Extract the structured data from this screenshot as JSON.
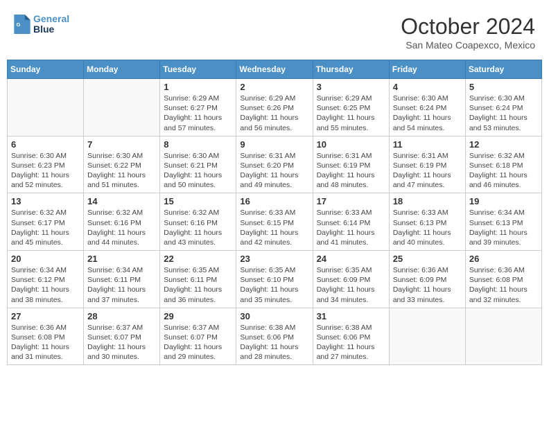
{
  "logo": {
    "line1": "General",
    "line2": "Blue"
  },
  "title": "October 2024",
  "subtitle": "San Mateo Coapexco, Mexico",
  "weekdays": [
    "Sunday",
    "Monday",
    "Tuesday",
    "Wednesday",
    "Thursday",
    "Friday",
    "Saturday"
  ],
  "weeks": [
    [
      {
        "day": "",
        "info": ""
      },
      {
        "day": "",
        "info": ""
      },
      {
        "day": "1",
        "info": "Sunrise: 6:29 AM\nSunset: 6:27 PM\nDaylight: 11 hours and 57 minutes."
      },
      {
        "day": "2",
        "info": "Sunrise: 6:29 AM\nSunset: 6:26 PM\nDaylight: 11 hours and 56 minutes."
      },
      {
        "day": "3",
        "info": "Sunrise: 6:29 AM\nSunset: 6:25 PM\nDaylight: 11 hours and 55 minutes."
      },
      {
        "day": "4",
        "info": "Sunrise: 6:30 AM\nSunset: 6:24 PM\nDaylight: 11 hours and 54 minutes."
      },
      {
        "day": "5",
        "info": "Sunrise: 6:30 AM\nSunset: 6:24 PM\nDaylight: 11 hours and 53 minutes."
      }
    ],
    [
      {
        "day": "6",
        "info": "Sunrise: 6:30 AM\nSunset: 6:23 PM\nDaylight: 11 hours and 52 minutes."
      },
      {
        "day": "7",
        "info": "Sunrise: 6:30 AM\nSunset: 6:22 PM\nDaylight: 11 hours and 51 minutes."
      },
      {
        "day": "8",
        "info": "Sunrise: 6:30 AM\nSunset: 6:21 PM\nDaylight: 11 hours and 50 minutes."
      },
      {
        "day": "9",
        "info": "Sunrise: 6:31 AM\nSunset: 6:20 PM\nDaylight: 11 hours and 49 minutes."
      },
      {
        "day": "10",
        "info": "Sunrise: 6:31 AM\nSunset: 6:19 PM\nDaylight: 11 hours and 48 minutes."
      },
      {
        "day": "11",
        "info": "Sunrise: 6:31 AM\nSunset: 6:19 PM\nDaylight: 11 hours and 47 minutes."
      },
      {
        "day": "12",
        "info": "Sunrise: 6:32 AM\nSunset: 6:18 PM\nDaylight: 11 hours and 46 minutes."
      }
    ],
    [
      {
        "day": "13",
        "info": "Sunrise: 6:32 AM\nSunset: 6:17 PM\nDaylight: 11 hours and 45 minutes."
      },
      {
        "day": "14",
        "info": "Sunrise: 6:32 AM\nSunset: 6:16 PM\nDaylight: 11 hours and 44 minutes."
      },
      {
        "day": "15",
        "info": "Sunrise: 6:32 AM\nSunset: 6:16 PM\nDaylight: 11 hours and 43 minutes."
      },
      {
        "day": "16",
        "info": "Sunrise: 6:33 AM\nSunset: 6:15 PM\nDaylight: 11 hours and 42 minutes."
      },
      {
        "day": "17",
        "info": "Sunrise: 6:33 AM\nSunset: 6:14 PM\nDaylight: 11 hours and 41 minutes."
      },
      {
        "day": "18",
        "info": "Sunrise: 6:33 AM\nSunset: 6:13 PM\nDaylight: 11 hours and 40 minutes."
      },
      {
        "day": "19",
        "info": "Sunrise: 6:34 AM\nSunset: 6:13 PM\nDaylight: 11 hours and 39 minutes."
      }
    ],
    [
      {
        "day": "20",
        "info": "Sunrise: 6:34 AM\nSunset: 6:12 PM\nDaylight: 11 hours and 38 minutes."
      },
      {
        "day": "21",
        "info": "Sunrise: 6:34 AM\nSunset: 6:11 PM\nDaylight: 11 hours and 37 minutes."
      },
      {
        "day": "22",
        "info": "Sunrise: 6:35 AM\nSunset: 6:11 PM\nDaylight: 11 hours and 36 minutes."
      },
      {
        "day": "23",
        "info": "Sunrise: 6:35 AM\nSunset: 6:10 PM\nDaylight: 11 hours and 35 minutes."
      },
      {
        "day": "24",
        "info": "Sunrise: 6:35 AM\nSunset: 6:09 PM\nDaylight: 11 hours and 34 minutes."
      },
      {
        "day": "25",
        "info": "Sunrise: 6:36 AM\nSunset: 6:09 PM\nDaylight: 11 hours and 33 minutes."
      },
      {
        "day": "26",
        "info": "Sunrise: 6:36 AM\nSunset: 6:08 PM\nDaylight: 11 hours and 32 minutes."
      }
    ],
    [
      {
        "day": "27",
        "info": "Sunrise: 6:36 AM\nSunset: 6:08 PM\nDaylight: 11 hours and 31 minutes."
      },
      {
        "day": "28",
        "info": "Sunrise: 6:37 AM\nSunset: 6:07 PM\nDaylight: 11 hours and 30 minutes."
      },
      {
        "day": "29",
        "info": "Sunrise: 6:37 AM\nSunset: 6:07 PM\nDaylight: 11 hours and 29 minutes."
      },
      {
        "day": "30",
        "info": "Sunrise: 6:38 AM\nSunset: 6:06 PM\nDaylight: 11 hours and 28 minutes."
      },
      {
        "day": "31",
        "info": "Sunrise: 6:38 AM\nSunset: 6:06 PM\nDaylight: 11 hours and 27 minutes."
      },
      {
        "day": "",
        "info": ""
      },
      {
        "day": "",
        "info": ""
      }
    ]
  ]
}
